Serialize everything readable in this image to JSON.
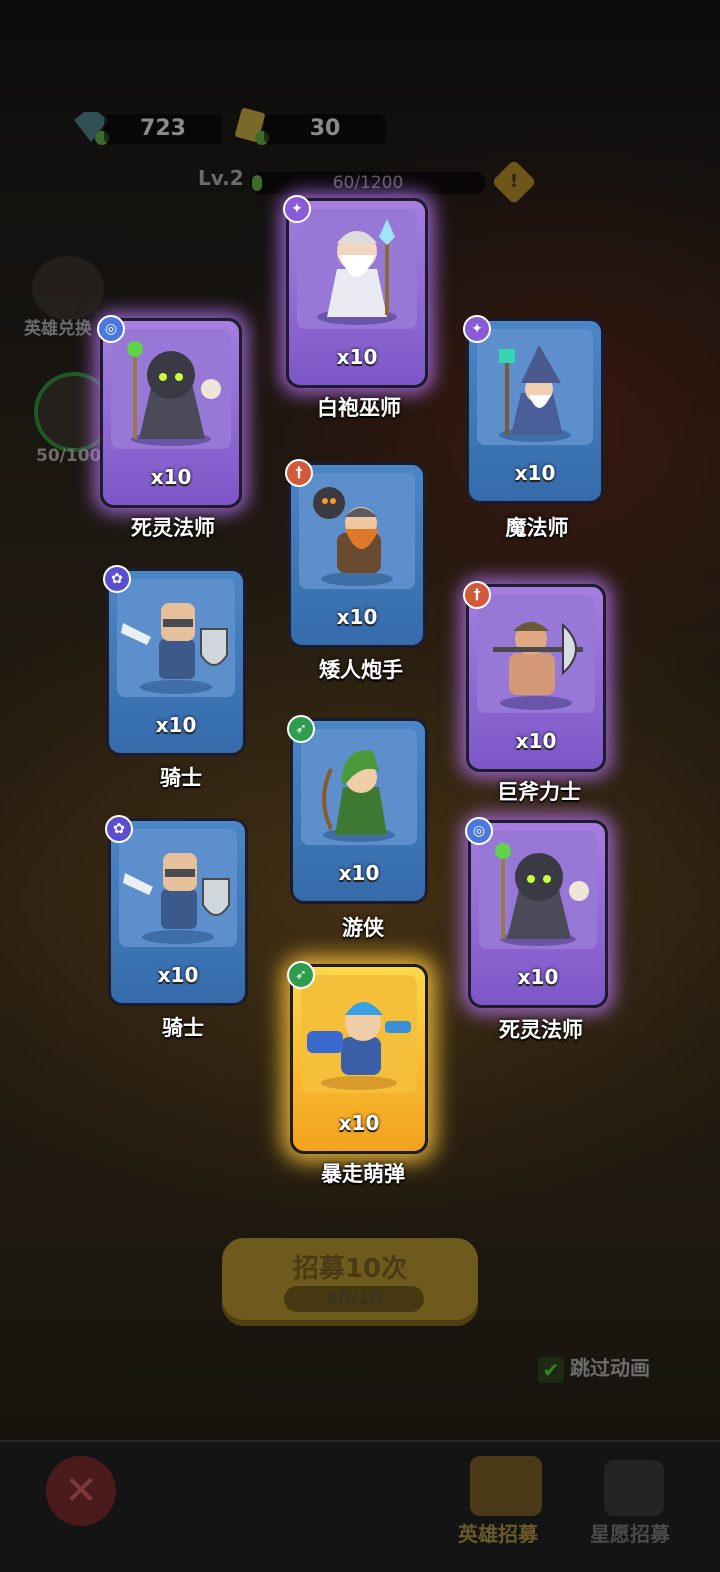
{
  "resources": {
    "gems": "723",
    "tickets": "30"
  },
  "level": {
    "label": "Lv.2",
    "xp": "60/1200",
    "warning": "!"
  },
  "side": {
    "exchange_label": "英雄兑换",
    "progress_label": "50/100"
  },
  "cards": [
    {
      "name": "白袍巫师",
      "count": "x10",
      "badge": "✦"
    },
    {
      "name": "死灵法师",
      "count": "x10",
      "badge": "◎"
    },
    {
      "name": "魔法师",
      "count": "x10",
      "badge": "✦"
    },
    {
      "name": "矮人炮手",
      "count": "x10",
      "badge": "†"
    },
    {
      "name": "骑士",
      "count": "x10",
      "badge": "✿"
    },
    {
      "name": "巨斧力士",
      "count": "x10",
      "badge": "†"
    },
    {
      "name": "游侠",
      "count": "x10",
      "badge": "➶"
    },
    {
      "name": "骑士",
      "count": "x10",
      "badge": "✿"
    },
    {
      "name": "死灵法师",
      "count": "x10",
      "badge": "◎"
    },
    {
      "name": "暴走萌弹",
      "count": "x10",
      "badge": "➶"
    }
  ],
  "recruit": {
    "label": "招募10次",
    "cost": "30/10"
  },
  "skip": {
    "label": "跳过动画",
    "check": "✔"
  },
  "tabs": {
    "close": "✕",
    "hero_recruit": "英雄招募",
    "wish_recruit": "星愿招募"
  },
  "colors": {
    "blue_card": "#4b86c7",
    "purple_card": "#a77fe0",
    "gold_card": "#ffd84a"
  }
}
